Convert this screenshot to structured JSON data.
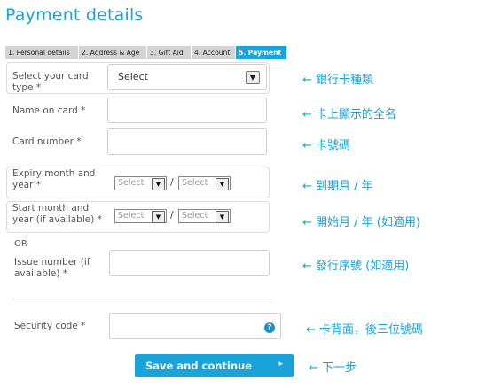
{
  "title": "Payment details",
  "tabs": [
    "1. Personal details",
    "2. Address & Age",
    "3. Gift Aid",
    "4. Account",
    "5. Payment"
  ],
  "form": {
    "card_type_label": "Select your card type *",
    "card_type_value": "Select",
    "name_label": "Name on card *",
    "number_label": "Card number *",
    "expiry_label": "Expiry month and year *",
    "start_label": "Start month and year (if available) *",
    "select_placeholder": "Select",
    "slash": "/",
    "or_text": "OR",
    "issue_label": "Issue number (if available) *",
    "security_label": "Security code *",
    "help_glyph": "?",
    "submit_label": "Save and continue",
    "submit_glyph": "▸"
  },
  "annotations": [
    "← 銀行卡種類",
    "← 卡上顯示的全名",
    "← 卡號碼",
    "← 到期月 / 年",
    "← 開始月 / 年 (如適用)",
    "← 發行序號 (如適用)",
    "← 卡背面，後三位號碼",
    "← 下一步"
  ],
  "colors": {
    "accent": "#19a3d9",
    "tab_inactive": "#d4d4d4",
    "help_icon": "#1d8fd0"
  }
}
